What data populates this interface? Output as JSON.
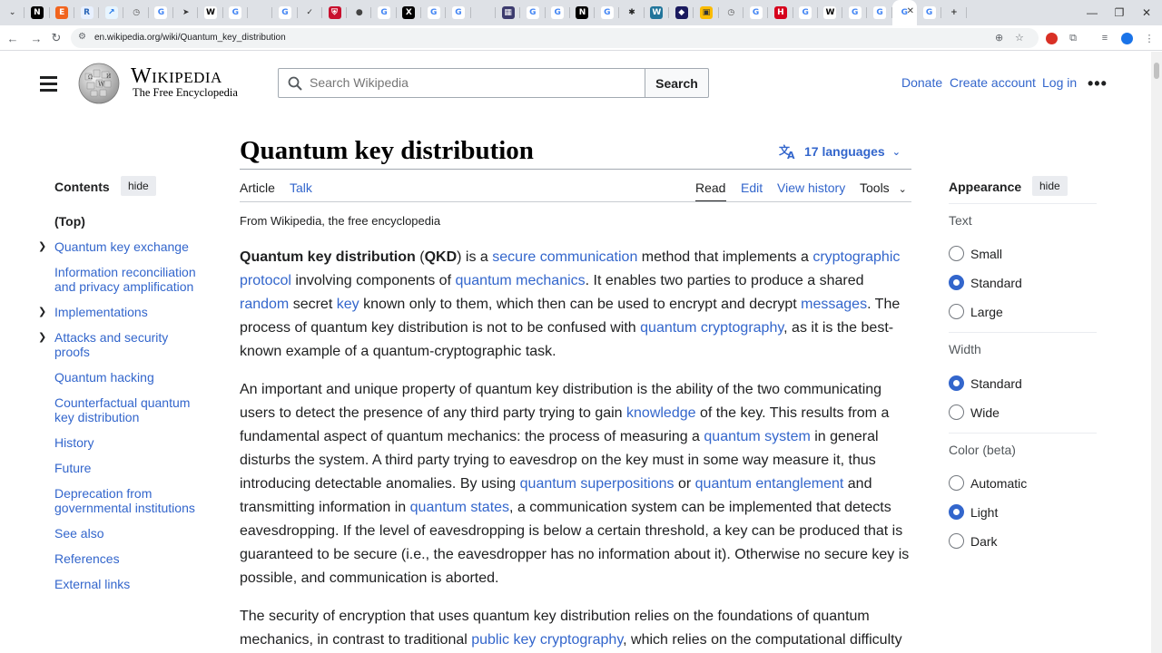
{
  "browser": {
    "url": "en.wikipedia.org/wiki/Quantum_key_distribution",
    "tab_favicons": [
      {
        "name": "chevron-down-icon",
        "glyph": "⌄",
        "bg": "transparent",
        "fg": "#444"
      },
      {
        "name": "notion-icon",
        "glyph": "N",
        "bg": "#000",
        "fg": "#fff"
      },
      {
        "name": "etsy-icon",
        "glyph": "E",
        "bg": "#f1641e",
        "fg": "#fff"
      },
      {
        "name": "rstudio-icon",
        "glyph": "R",
        "bg": "#e8f0fe",
        "fg": "#2a66b8"
      },
      {
        "name": "link-icon",
        "glyph": "↗",
        "bg": "#e8f5ff",
        "fg": "#1a73e8"
      },
      {
        "name": "clock-icon",
        "glyph": "◷",
        "bg": "transparent",
        "fg": "#555"
      },
      {
        "name": "google-icon",
        "glyph": "G",
        "bg": "#fff",
        "fg": "#4285f4"
      },
      {
        "name": "arrow-icon",
        "glyph": "➤",
        "bg": "transparent",
        "fg": "#333"
      },
      {
        "name": "wikipedia-icon",
        "glyph": "W",
        "bg": "#fff",
        "fg": "#000"
      },
      {
        "name": "google-icon",
        "glyph": "G",
        "bg": "#fff",
        "fg": "#4285f4"
      },
      {
        "name": "blank-icon",
        "glyph": "",
        "bg": "transparent",
        "fg": "#000"
      },
      {
        "name": "google-icon",
        "glyph": "G",
        "bg": "#fff",
        "fg": "#4285f4"
      },
      {
        "name": "check-icon",
        "glyph": "✓",
        "bg": "transparent",
        "fg": "#333"
      },
      {
        "name": "shield-icon",
        "glyph": "⛨",
        "bg": "#c8102e",
        "fg": "#fff"
      },
      {
        "name": "ball-icon",
        "glyph": "●",
        "bg": "transparent",
        "fg": "#444"
      },
      {
        "name": "google-icon",
        "glyph": "G",
        "bg": "#fff",
        "fg": "#4285f4"
      },
      {
        "name": "x-logo-icon",
        "glyph": "X",
        "bg": "#000",
        "fg": "#fff"
      },
      {
        "name": "google-icon",
        "glyph": "G",
        "bg": "#fff",
        "fg": "#4285f4"
      },
      {
        "name": "google-icon",
        "glyph": "G",
        "bg": "#fff",
        "fg": "#4285f4"
      },
      {
        "name": "blank-icon",
        "glyph": "",
        "bg": "transparent",
        "fg": "#000"
      },
      {
        "name": "flag-icon",
        "glyph": "▦",
        "bg": "#3c3b6e",
        "fg": "#fff"
      },
      {
        "name": "google-icon",
        "glyph": "G",
        "bg": "#fff",
        "fg": "#4285f4"
      },
      {
        "name": "google-icon",
        "glyph": "G",
        "bg": "#fff",
        "fg": "#4285f4"
      },
      {
        "name": "notion-icon",
        "glyph": "N",
        "bg": "#000",
        "fg": "#fff"
      },
      {
        "name": "google-icon",
        "glyph": "G",
        "bg": "#fff",
        "fg": "#4285f4"
      },
      {
        "name": "gear-icon",
        "glyph": "✱",
        "bg": "transparent",
        "fg": "#222"
      },
      {
        "name": "wordpress-icon",
        "glyph": "W",
        "bg": "#21759b",
        "fg": "#fff"
      },
      {
        "name": "cube-icon",
        "glyph": "◆",
        "bg": "#1a1a5e",
        "fg": "#fff"
      },
      {
        "name": "photo-icon",
        "glyph": "▣",
        "bg": "#fbbc04",
        "fg": "#333"
      },
      {
        "name": "clock-icon",
        "glyph": "◷",
        "bg": "transparent",
        "fg": "#555"
      },
      {
        "name": "google-icon",
        "glyph": "G",
        "bg": "#fff",
        "fg": "#4285f4"
      },
      {
        "name": "hbo-icon",
        "glyph": "H",
        "bg": "#d6001c",
        "fg": "#fff"
      },
      {
        "name": "google-icon",
        "glyph": "G",
        "bg": "#fff",
        "fg": "#4285f4"
      },
      {
        "name": "wikipedia-icon",
        "glyph": "W",
        "bg": "#fff",
        "fg": "#000"
      },
      {
        "name": "google-icon",
        "glyph": "G",
        "bg": "#fff",
        "fg": "#4285f4"
      },
      {
        "name": "google-icon",
        "glyph": "G",
        "bg": "#fff",
        "fg": "#4285f4"
      },
      {
        "name": "google-icon",
        "glyph": "G",
        "bg": "#fff",
        "fg": "#4285f4"
      },
      {
        "name": "google-icon",
        "glyph": "G",
        "bg": "#fff",
        "fg": "#4285f4"
      },
      {
        "name": "new-tab-icon",
        "glyph": "+",
        "bg": "transparent",
        "fg": "#333"
      }
    ]
  },
  "header": {
    "logo_word": "Wikipedia",
    "logo_tagline": "The Free Encyclopedia",
    "search_placeholder": "Search Wikipedia",
    "search_button": "Search",
    "donate": "Donate",
    "create_account": "Create account",
    "log_in": "Log in"
  },
  "toc": {
    "title": "Contents",
    "hide_label": "hide",
    "items": [
      {
        "label": "(Top)"
      },
      {
        "label": "Quantum key exchange"
      },
      {
        "label": "Information reconciliation and privacy amplification"
      },
      {
        "label": "Implementations"
      },
      {
        "label": "Attacks and security proofs"
      },
      {
        "label": "Quantum hacking"
      },
      {
        "label": "Counterfactual quantum key distribution"
      },
      {
        "label": "History"
      },
      {
        "label": "Future"
      },
      {
        "label": "Deprecation from governmental institutions"
      },
      {
        "label": "See also"
      },
      {
        "label": "References"
      },
      {
        "label": "External links"
      }
    ]
  },
  "article": {
    "title": "Quantum key distribution",
    "languages": "17 languages",
    "tabs": {
      "article": "Article",
      "talk": "Talk",
      "read": "Read",
      "edit": "Edit",
      "history": "View history",
      "tools": "Tools"
    },
    "tagline": "From Wikipedia, the free encyclopedia",
    "p1": [
      {
        "t": "Quantum key distribution",
        "b": true
      },
      {
        "t": " ("
      },
      {
        "t": "QKD",
        "b": true
      },
      {
        "t": ") is a "
      },
      {
        "t": "secure communication",
        "link": true
      },
      {
        "t": " method that implements a "
      },
      {
        "t": "cryptographic protocol",
        "link": true
      },
      {
        "t": " involving components of "
      },
      {
        "t": "quantum mechanics",
        "link": true
      },
      {
        "t": ". It enables two parties to produce a shared "
      },
      {
        "t": "random",
        "link": true
      },
      {
        "t": " secret "
      },
      {
        "t": "key",
        "link": true
      },
      {
        "t": " known only to them, which then can be used to encrypt and decrypt "
      },
      {
        "t": "messages",
        "link": true
      },
      {
        "t": ". The process of quantum key distribution is not to be confused with "
      },
      {
        "t": "quantum cryptography",
        "link": true
      },
      {
        "t": ", as it is the best-known example of a quantum-cryptographic task."
      }
    ],
    "p2": [
      {
        "t": "An important and unique property of quantum key distribution is the ability of the two communicating users to detect the presence of any third party trying to gain "
      },
      {
        "t": "knowledge",
        "link": true
      },
      {
        "t": " of the key. This results from a fundamental aspect of quantum mechanics: the process of measuring a "
      },
      {
        "t": "quantum system",
        "link": true
      },
      {
        "t": " in general disturbs the system. A third party trying to eavesdrop on the key must in some way measure it, thus introducing detectable anomalies. By using "
      },
      {
        "t": "quantum superpositions",
        "link": true
      },
      {
        "t": " or "
      },
      {
        "t": "quantum entanglement",
        "link": true
      },
      {
        "t": " and transmitting information in "
      },
      {
        "t": "quantum states",
        "link": true
      },
      {
        "t": ", a communication system can be implemented that detects eavesdropping. If the level of eavesdropping is below a certain threshold, a key can be produced that is guaranteed to be secure (i.e., the eavesdropper has no information about it). Otherwise no secure key is possible, and communication is aborted."
      }
    ],
    "p3": [
      {
        "t": "The security of encryption that uses quantum key distribution relies on the foundations of quantum mechanics, in contrast to traditional "
      },
      {
        "t": "public key cryptography",
        "link": true
      },
      {
        "t": ", which relies on the computational difficulty"
      }
    ]
  },
  "appearance": {
    "title": "Appearance",
    "hide_label": "hide",
    "text_label": "Text",
    "text_options": [
      {
        "label": "Small",
        "selected": false
      },
      {
        "label": "Standard",
        "selected": true
      },
      {
        "label": "Large",
        "selected": false
      }
    ],
    "width_label": "Width",
    "width_options": [
      {
        "label": "Standard",
        "selected": true
      },
      {
        "label": "Wide",
        "selected": false
      }
    ],
    "color_label": "Color (beta)",
    "color_options": [
      {
        "label": "Automatic",
        "selected": false
      },
      {
        "label": "Light",
        "selected": true
      },
      {
        "label": "Dark",
        "selected": false
      }
    ]
  },
  "colors": {
    "link": "#3366cc",
    "accent": "#3366cc",
    "text": "#202122"
  }
}
